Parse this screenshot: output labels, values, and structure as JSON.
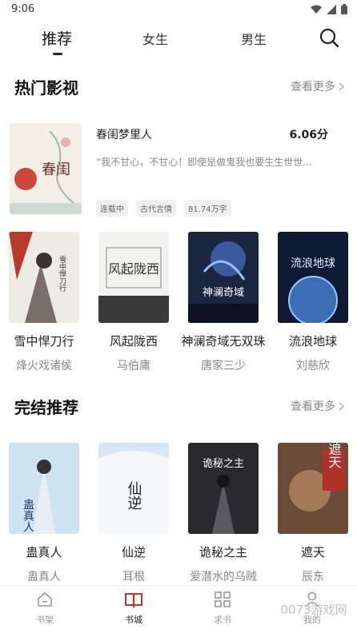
{
  "status": {
    "time": "9:06"
  },
  "tabs": [
    {
      "label": "推荐",
      "active": true
    },
    {
      "label": "女生",
      "active": false
    },
    {
      "label": "男生",
      "active": false
    }
  ],
  "hot": {
    "title": "热门影视",
    "more": "查看更多",
    "featured": {
      "title": "春闺梦里人",
      "score": "6.06分",
      "desc": "“我不甘心，不甘心！即使是做鬼我也要生生世世...",
      "tags": [
        "连载中",
        "古代言情",
        "81.74万字"
      ],
      "cover_text": "春闺"
    },
    "books": [
      {
        "title": "雪中悍刀行",
        "author": "烽火戏诸侯",
        "cover_text": "雪中悍刀行"
      },
      {
        "title": "风起陇西",
        "author": "马伯庸",
        "cover_text": "风起陇西"
      },
      {
        "title": "神澜奇域无双珠",
        "author": "唐家三少",
        "cover_text": "神澜奇域"
      },
      {
        "title": "流浪地球",
        "author": "刘慈欣",
        "cover_text": "流浪地球"
      }
    ]
  },
  "finished": {
    "title": "完结推荐",
    "more": "查看更多",
    "books": [
      {
        "title": "蛊真人",
        "author": "蛊真人",
        "cover_text": "蛊真人"
      },
      {
        "title": "仙逆",
        "author": "耳根",
        "cover_text": "仙逆"
      },
      {
        "title": "诡秘之主",
        "author": "爱潜水的乌贼",
        "cover_text": "诡秘之主"
      },
      {
        "title": "遮天",
        "author": "辰东",
        "cover_text": "遮天"
      }
    ]
  },
  "nav": [
    {
      "label": "书架",
      "icon": "bookshelf-icon"
    },
    {
      "label": "书城",
      "icon": "bookstore-icon",
      "active": true
    },
    {
      "label": "求书",
      "icon": "grid-icon"
    },
    {
      "label": "我的",
      "icon": "profile-icon"
    }
  ],
  "watermark": "0073游戏网"
}
